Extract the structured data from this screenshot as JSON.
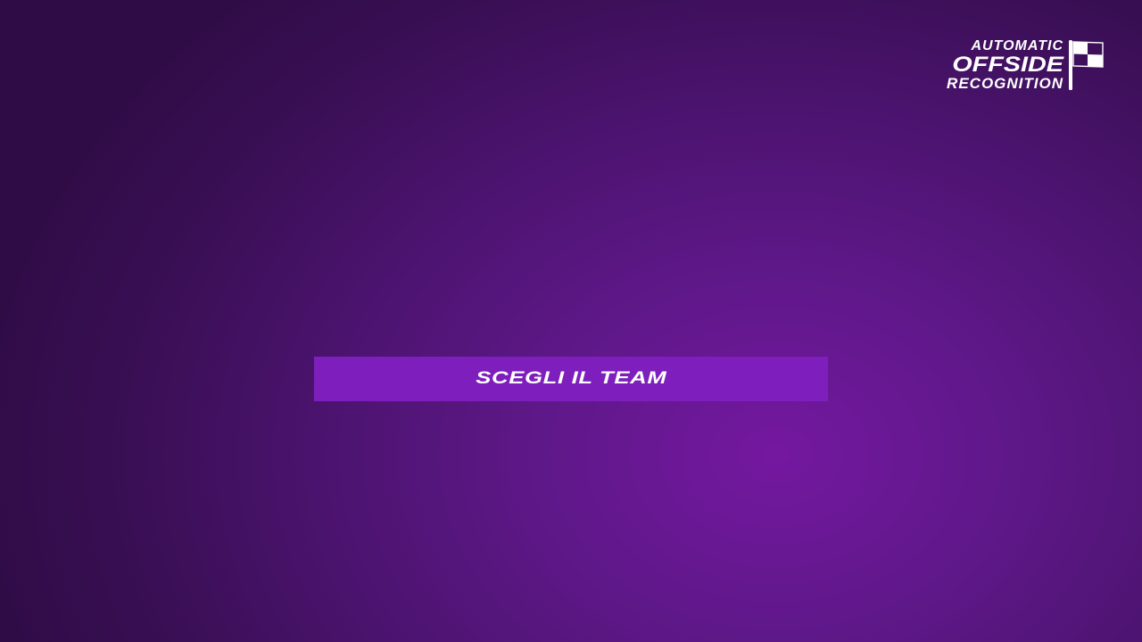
{
  "logo": {
    "line1": "AUTOMATIC",
    "line2": "OFFSIDE",
    "line3": "RECOGNITION",
    "icon": "checkered-flag-icon"
  },
  "main": {
    "choose_team_button_label": "SCEGLI IL TEAM"
  },
  "colors": {
    "background_dark": "#2f0c46",
    "background_glow": "#7418a0",
    "button": "#7e1fbd",
    "text": "#ffffff"
  }
}
